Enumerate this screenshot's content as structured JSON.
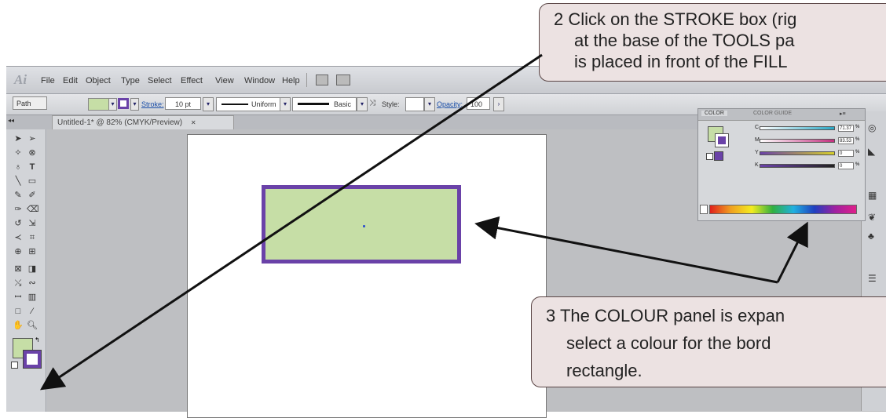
{
  "menubar": {
    "logo": "Ai",
    "items": [
      "File",
      "Edit",
      "Object",
      "Type",
      "Select",
      "Effect",
      "View",
      "Window",
      "Help"
    ]
  },
  "controlbar": {
    "selection": "Path",
    "stroke_label": "Stroke:",
    "stroke_weight": "10 pt",
    "profile": "Uniform",
    "brush": "Basic",
    "style_label": "Style:",
    "opacity_label": "Opacity:",
    "opacity_value": "100"
  },
  "document": {
    "tab_title": "Untitled-1* @ 82% (CMYK/Preview)",
    "close_glyph": "✕"
  },
  "color_panel": {
    "tabs": [
      "COLOR",
      "COLOR GUIDE"
    ],
    "sliders": [
      {
        "label": "C",
        "value": "71.37",
        "unit": "%",
        "color": "#2aa7c4"
      },
      {
        "label": "M",
        "value": "83.53",
        "unit": "%",
        "color": "#c2307e"
      },
      {
        "label": "Y",
        "value": "0",
        "unit": "%",
        "color": "#d6cf2a"
      },
      {
        "label": "K",
        "value": "0",
        "unit": "%",
        "color": "#333333"
      }
    ]
  },
  "colors": {
    "fill": "#c6dea6",
    "stroke": "#6a42a8",
    "callout_bg": "#ece2e2",
    "arrow": "#111111"
  },
  "callouts": {
    "step2": [
      "2  Click on the STROKE box (rig",
      "at the base of the TOOLS pa",
      "is placed in front of the FILL"
    ],
    "step3": [
      "3  The COLOUR panel is expan",
      "select a colour for the bord",
      "rectangle."
    ]
  }
}
